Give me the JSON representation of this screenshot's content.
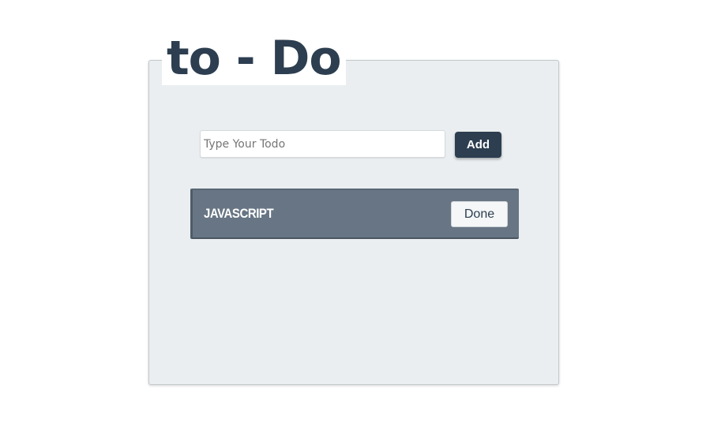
{
  "app": {
    "title": "to - Do"
  },
  "form": {
    "input_value": "",
    "input_placeholder": "Type Your Todo",
    "add_label": "Add"
  },
  "todos": [
    {
      "text": "JAVASCRIPT",
      "done_label": "Done"
    }
  ],
  "colors": {
    "primary": "#2c3e50",
    "card_bg": "#eaeef0",
    "item_bg": "#677584"
  }
}
